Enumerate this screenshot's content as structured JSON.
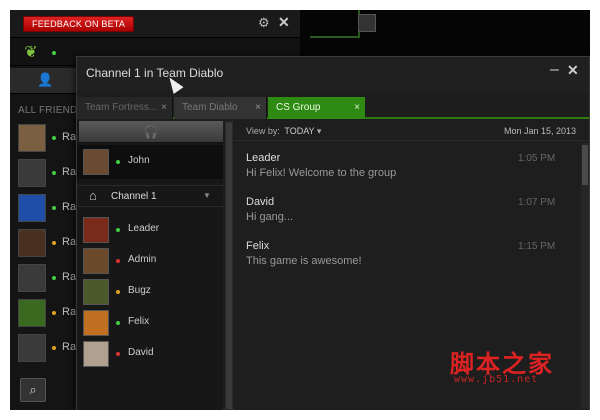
{
  "background_app": {
    "feedback_label": "FEEDBACK ON BETA",
    "all_friends_label": "ALL FRIENDS",
    "friends": [
      {
        "name": "Ra",
        "status": "online",
        "color": "#7a6040"
      },
      {
        "name": "Ra",
        "status": "online",
        "color": "#3a3a3a"
      },
      {
        "name": "Ra",
        "status": "online",
        "color": "#1e4fa8"
      },
      {
        "name": "Ra",
        "status": "away",
        "color": "#4a3020"
      },
      {
        "name": "Ra",
        "status": "online",
        "color": "#3a3a3a"
      },
      {
        "name": "Ra",
        "status": "away",
        "color": "#3a6a20"
      },
      {
        "name": "Ra",
        "status": "away",
        "color": "#3a3a3a"
      }
    ]
  },
  "chat": {
    "title": "Channel 1 in Team Diablo",
    "tabs": [
      {
        "label": "Team Fortress...",
        "close": "×",
        "active": false
      },
      {
        "label": "Team Diablo",
        "close": "×",
        "active": false
      },
      {
        "label": "CS Group",
        "close": "×",
        "active": true
      }
    ],
    "voice_user": {
      "name": "John",
      "status": "online"
    },
    "channel_name": "Channel 1",
    "members": [
      {
        "name": "Leader",
        "status": "online",
        "color": "#7a2a1a"
      },
      {
        "name": "Admin",
        "status": "busy",
        "color": "#6a4a2a"
      },
      {
        "name": "Bugz",
        "status": "away",
        "color": "#4a5a2a"
      },
      {
        "name": "Felix",
        "status": "online",
        "color": "#c07020"
      },
      {
        "name": "David",
        "status": "busy",
        "color": "#b0a090"
      }
    ],
    "view_by_label": "View by:",
    "view_by_value": "TODAY",
    "date": "Mon Jan 15, 2013",
    "messages": [
      {
        "author": "Leader",
        "text": "Hi Felix! Welcome to the group",
        "time": "1:05 PM"
      },
      {
        "author": "David",
        "text": "Hi gang...",
        "time": "1:07 PM"
      },
      {
        "author": "Felix",
        "text": "This game is awesome!",
        "time": "1:15 PM"
      }
    ]
  },
  "status_colors": {
    "online": "#44cc44",
    "away": "#e0a020",
    "busy": "#dd3333"
  },
  "watermark": {
    "cn": "脚本之家",
    "url": "www.jb51.net"
  }
}
